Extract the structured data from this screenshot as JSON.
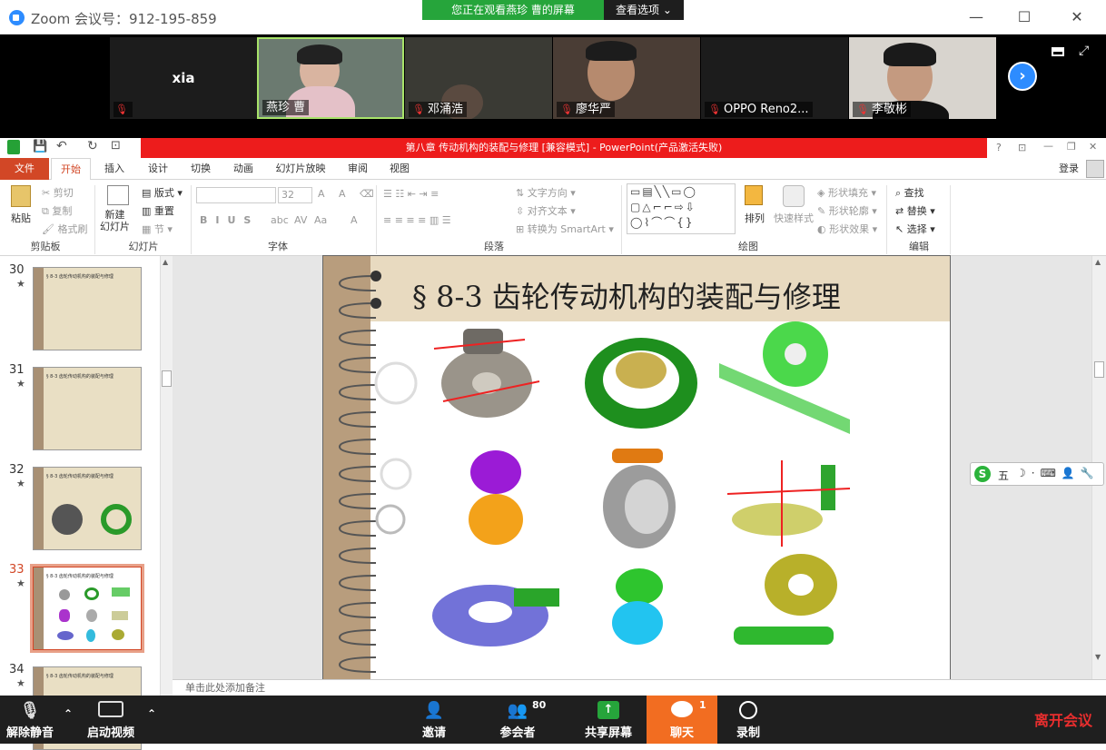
{
  "window": {
    "title": "Zoom 会议号：912-195-859",
    "minimize": "—",
    "maximize": "☐",
    "close": "✕"
  },
  "share_banner": {
    "text": "您正在观看燕珍 曹的屏幕",
    "view_options": "查看选项"
  },
  "participants": [
    {
      "name": "xia",
      "muted": true,
      "video": false
    },
    {
      "name": "燕珍 曹",
      "muted": false,
      "video": true
    },
    {
      "name": "邓涌浩",
      "muted": true,
      "video": true
    },
    {
      "name": "廖华严",
      "muted": true,
      "video": true
    },
    {
      "name": "OPPO Reno2...",
      "muted": true,
      "video": false
    },
    {
      "name": "李敬彬",
      "muted": true,
      "video": true
    }
  ],
  "ppt": {
    "title": "第八章 传动机构的装配与修理 [兼容模式] - PowerPoint(产品激活失败)",
    "tabs": [
      "文件",
      "开始",
      "插入",
      "设计",
      "切换",
      "动画",
      "幻灯片放映",
      "审阅",
      "视图"
    ],
    "login": "登录",
    "groups": [
      "剪贴板",
      "幻灯片",
      "字体",
      "段落",
      "绘图",
      "编辑"
    ],
    "clipboard": {
      "paste": "粘贴",
      "cut": "剪切",
      "copy": "复制",
      "format_painter": "格式刷"
    },
    "slides_grp": {
      "new_slide": "新建\n幻灯片",
      "layout": "版式",
      "reset": "重置",
      "section": "节"
    },
    "font": {
      "size": "32"
    },
    "paragraph": {
      "text_direction": "文字方向",
      "align_text": "对齐文本",
      "smartart": "转换为 SmartArt"
    },
    "drawing": {
      "arrange": "排列",
      "quick_styles": "快速样式",
      "shape_fill": "形状填充",
      "shape_outline": "形状轮廓",
      "shape_effects": "形状效果"
    },
    "editing": {
      "find": "查找",
      "replace": "替换",
      "select": "选择"
    },
    "thumbnails": [
      {
        "num": "30",
        "heading": "§ 8-3  齿轮传动机构的装配与修理"
      },
      {
        "num": "31",
        "heading": "§ 8-3  齿轮传动机构的装配与修理"
      },
      {
        "num": "32",
        "heading": "§ 8-3  齿轮传动机构的装配与修理"
      },
      {
        "num": "33",
        "heading": "§ 8-3  齿轮传动机构的装配与修理"
      },
      {
        "num": "34",
        "heading": "§ 8-3  齿轮传动机构的装配与修理"
      }
    ],
    "slide_title": "§ 8-3   齿轮传动机构的装配与修理",
    "notes": "单击此处添加备注"
  },
  "sogou": {
    "text": "五"
  },
  "toolbar": {
    "unmute": "解除静音",
    "start_video": "启动视频",
    "invite": "邀请",
    "participants": "参会者",
    "participants_count": "80",
    "share": "共享屏幕",
    "chat": "聊天",
    "chat_badge": "1",
    "record": "录制",
    "leave": "离开会议"
  },
  "colors": {
    "zoom_blue": "#2D8CFF",
    "share_green": "#26a53b",
    "ppt_red": "#ed1c1c",
    "ppt_orange": "#d24726",
    "chat_orange": "#f26d21",
    "leave_red": "#e82e2e"
  }
}
